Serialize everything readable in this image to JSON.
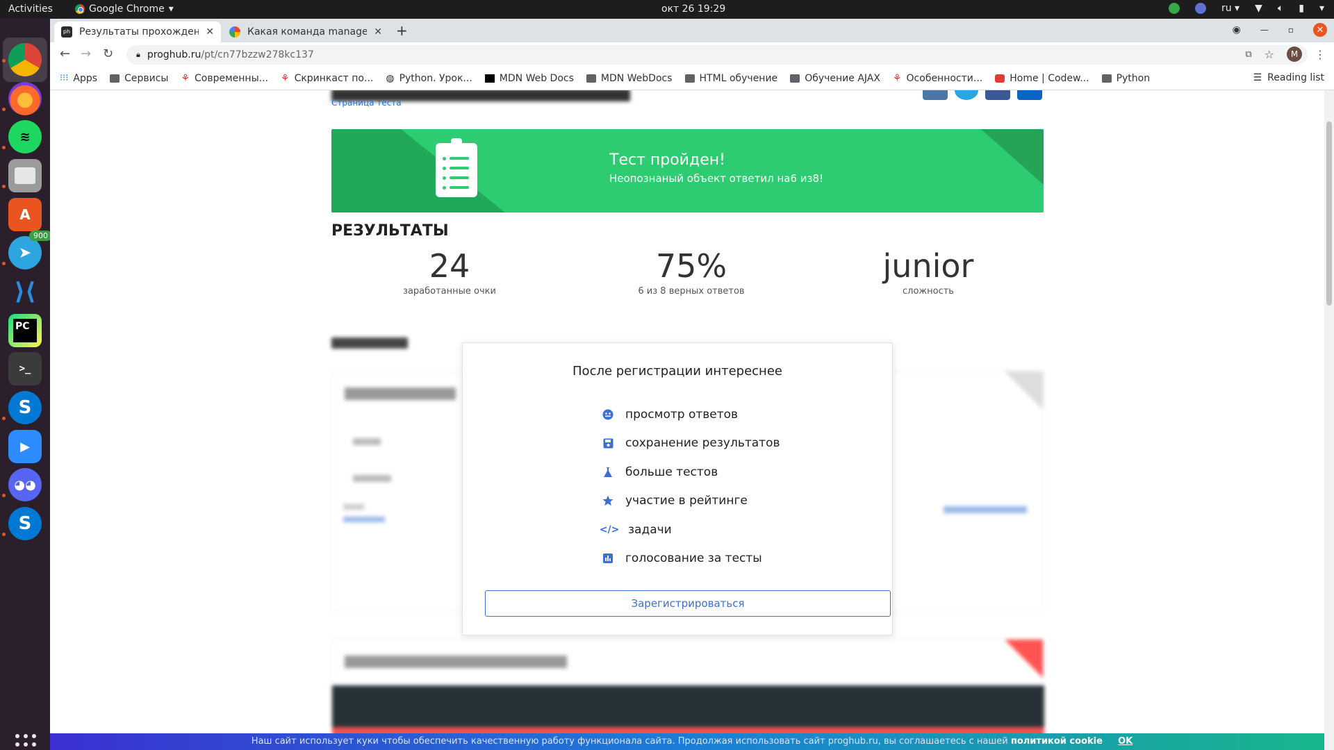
{
  "os": {
    "activities": "Activities",
    "app_name": "Google Chrome",
    "clock": "окт 26  19:29",
    "lang": "ru",
    "telegram_badge": "900"
  },
  "browser": {
    "tabs": [
      {
        "title": "Результаты прохождени",
        "favicon": "proghub-favicon"
      },
      {
        "title": "Какая команда manage.p",
        "favicon": "google-favicon"
      }
    ],
    "url_host": "proghub.ru",
    "url_path": "/pt/cn77bzzw278kc137",
    "avatar_letter": "M",
    "bookmarks": [
      {
        "label": "Apps",
        "icon": "apps-grid-icon"
      },
      {
        "label": "Сервисы",
        "icon": "folder-icon"
      },
      {
        "label": "Современны...",
        "icon": "site-icon"
      },
      {
        "label": "Скринкаст по...",
        "icon": "site-icon"
      },
      {
        "label": "Python. Урок...",
        "icon": "site-icon"
      },
      {
        "label": "MDN Web Docs",
        "icon": "mdn-icon"
      },
      {
        "label": "MDN WebDocs",
        "icon": "folder-icon"
      },
      {
        "label": "HTML обучение",
        "icon": "folder-icon"
      },
      {
        "label": "Обучение AJAX",
        "icon": "folder-icon"
      },
      {
        "label": "Особенности...",
        "icon": "site-icon"
      },
      {
        "label": "Home | Codew...",
        "icon": "codewars-icon"
      },
      {
        "label": "Python",
        "icon": "folder-icon"
      }
    ],
    "reading_list": "Reading list"
  },
  "page": {
    "test_page_link": "Страница теста",
    "banner": {
      "title": "Тест пройден!",
      "subtitle": "Неопознаный объект ответил на6 из8!"
    },
    "results_heading": "РЕЗУЛЬТАТЫ",
    "stats": [
      {
        "value": "24",
        "label": "заработанные очки"
      },
      {
        "value": "75%",
        "label": "6 из 8 верных ответов"
      },
      {
        "value": "junior",
        "label": "сложность"
      }
    ]
  },
  "modal": {
    "title": "После регистрации интереснее",
    "features": [
      {
        "label": "просмотр ответов",
        "icon": "eye-face-icon"
      },
      {
        "label": "сохранение результатов",
        "icon": "save-icon"
      },
      {
        "label": "больше тестов",
        "icon": "flask-icon"
      },
      {
        "label": "участие в рейтинге",
        "icon": "star-icon"
      },
      {
        "label": "задачи",
        "icon": "code-icon"
      },
      {
        "label": "голосование за тесты",
        "icon": "chart-icon"
      }
    ],
    "register_button": "Зарегистрироваться"
  },
  "cookie_bar": {
    "text": "Наш сайт использует куки чтобы обеспечить качественную работу функционала сайта. Продолжая использовать сайт proghub.ru, вы соглашаетесь с нашей",
    "link": "политикой cookie",
    "ok": "OK"
  },
  "colors": {
    "banner_green": "#2ecc71",
    "accent_blue": "#3b6fd4",
    "ubuntu_orange": "#e95420"
  }
}
